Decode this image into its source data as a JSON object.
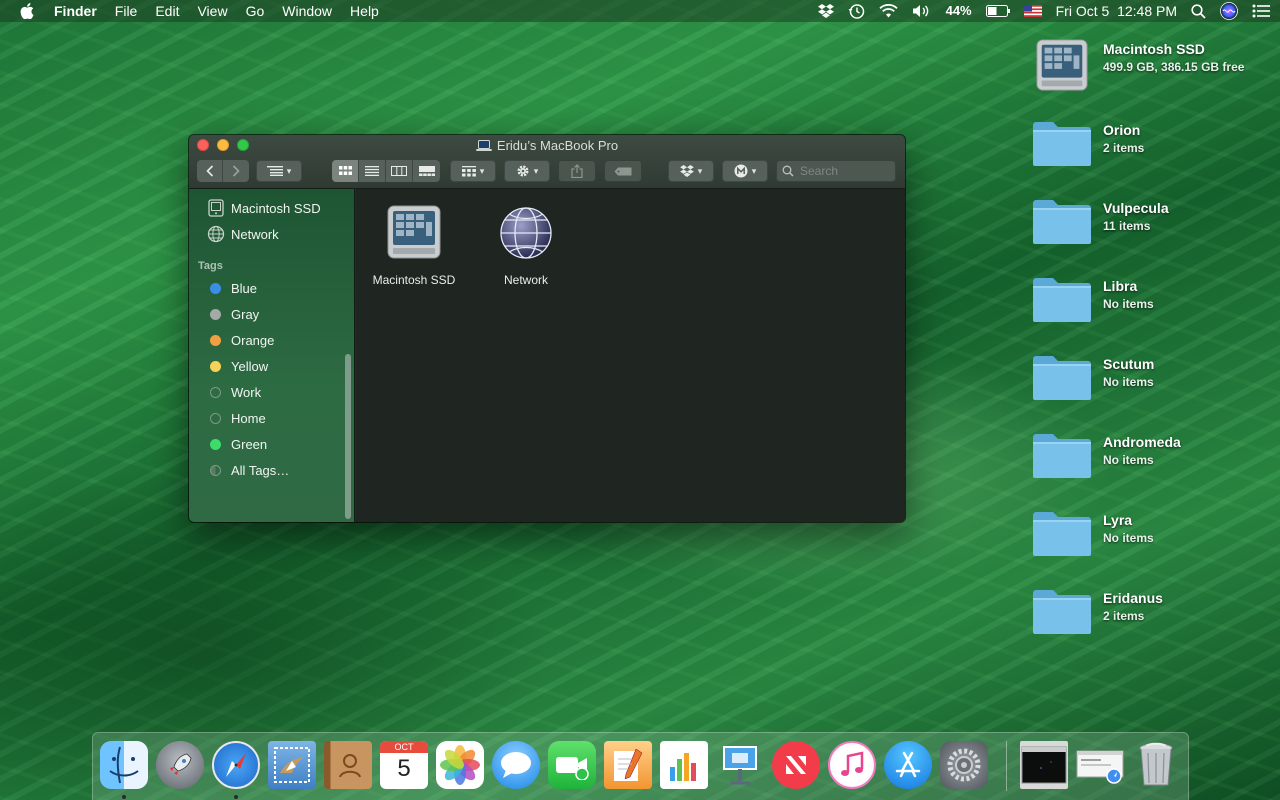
{
  "menubar": {
    "app_name": "Finder",
    "items": [
      "File",
      "Edit",
      "View",
      "Go",
      "Window",
      "Help"
    ],
    "battery": "44%",
    "datetime": "Fri Oct 5  12:48 PM"
  },
  "window": {
    "title": "Eridu’s MacBook Pro",
    "search_placeholder": "Search",
    "sidebar": {
      "devices": [
        "Macintosh SSD",
        "Network"
      ],
      "tags_heading": "Tags",
      "tags": [
        {
          "label": "Blue",
          "color": "#3a8ee6"
        },
        {
          "label": "Gray",
          "color": "#a5a9a7"
        },
        {
          "label": "Orange",
          "color": "#f0a042"
        },
        {
          "label": "Yellow",
          "color": "#f3d35a"
        },
        {
          "label": "Work",
          "color": ""
        },
        {
          "label": "Home",
          "color": ""
        },
        {
          "label": "Green",
          "color": "#3ddc6a"
        },
        {
          "label": "All Tags…",
          "color": ""
        }
      ]
    },
    "content_items": [
      "Macintosh SSD",
      "Network"
    ]
  },
  "desktop": [
    {
      "name": "Macintosh SSD",
      "sub": "499.9 GB, 386.15 GB free",
      "icon": "hard-drive-icon"
    },
    {
      "name": "Orion",
      "sub": "2 items",
      "icon": "folder-icon"
    },
    {
      "name": "Vulpecula",
      "sub": "11 items",
      "icon": "folder-icon"
    },
    {
      "name": "Libra",
      "sub": "No items",
      "icon": "folder-icon"
    },
    {
      "name": "Scutum",
      "sub": "No items",
      "icon": "folder-icon"
    },
    {
      "name": "Andromeda",
      "sub": "No items",
      "icon": "folder-icon"
    },
    {
      "name": "Lyra",
      "sub": "No items",
      "icon": "folder-icon"
    },
    {
      "name": "Eridanus",
      "sub": "2 items",
      "icon": "folder-icon"
    }
  ],
  "dock": {
    "calendar_month": "OCT",
    "calendar_day": "5",
    "apps": [
      "finder-icon",
      "launchpad-icon",
      "safari-icon",
      "mail-icon",
      "contacts-icon",
      "calendar-icon",
      "photos-icon",
      "messages-icon",
      "facetime-icon",
      "pages-icon",
      "numbers-icon",
      "keynote-icon",
      "news-icon",
      "itunes-icon",
      "app-store-icon",
      "system-preferences-icon",
      "minimized-window-icon",
      "minimized-window-icon",
      "trash-icon"
    ]
  }
}
